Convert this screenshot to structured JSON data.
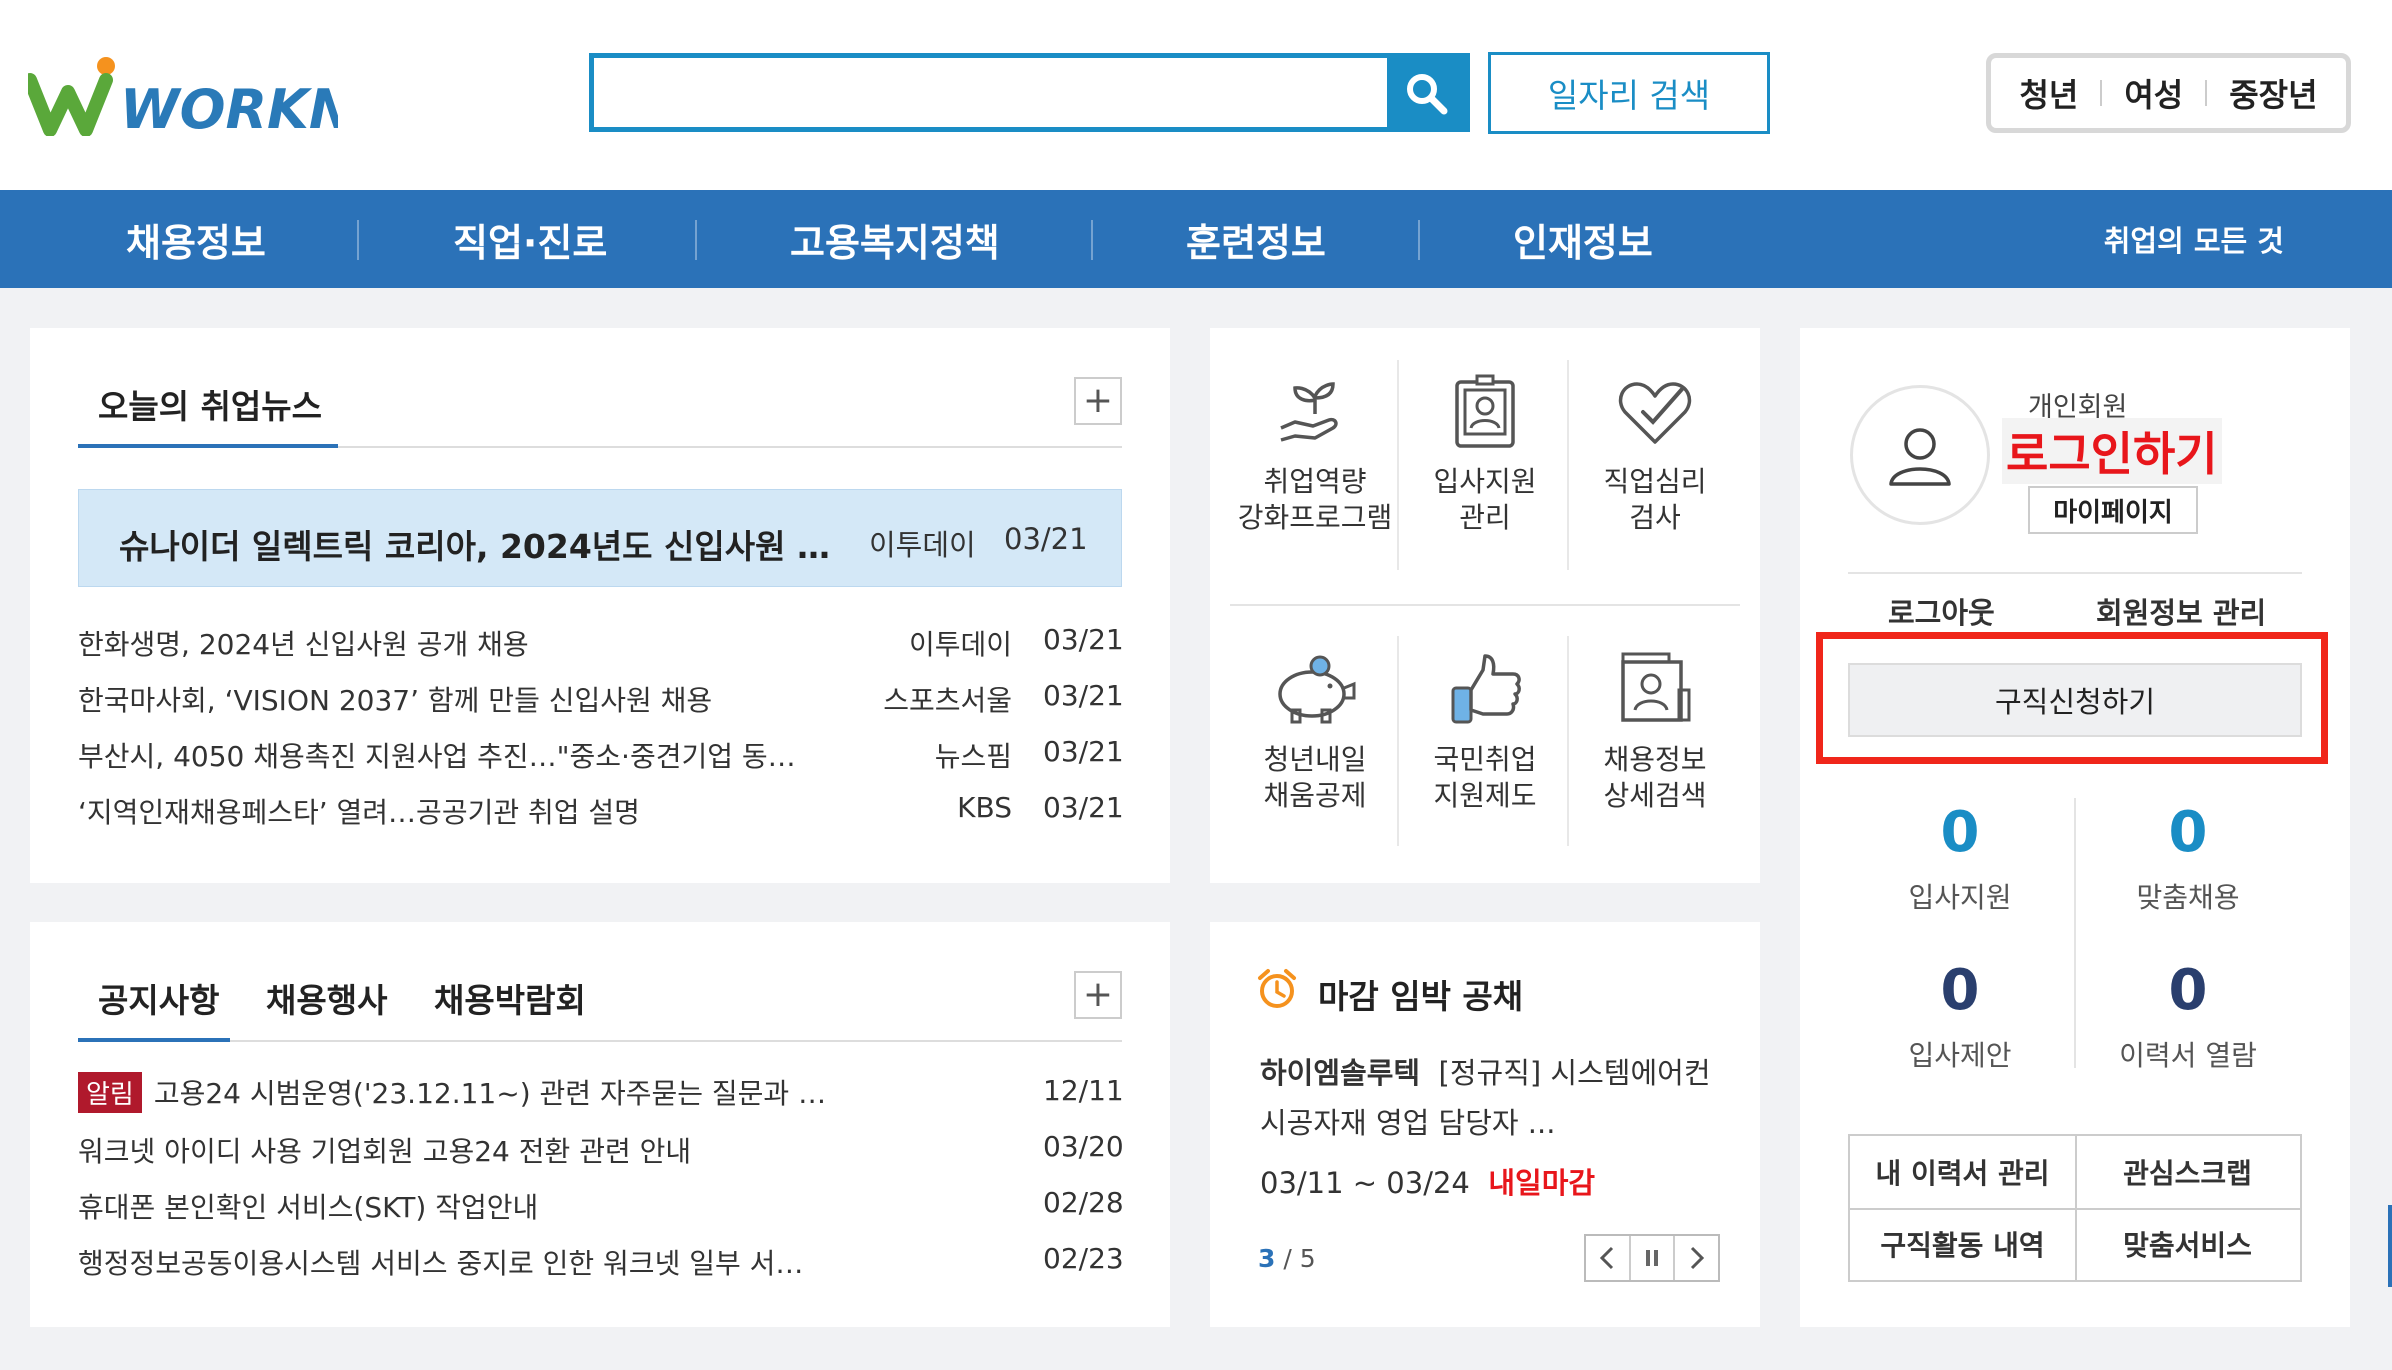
{
  "header": {
    "logo_text": "WORKNET",
    "search_placeholder": "",
    "job_search_label": "일자리 검색",
    "quick_tabs": [
      "청년",
      "여성",
      "중장년"
    ]
  },
  "nav": {
    "items": [
      "채용정보",
      "직업·진로",
      "고용복지정책",
      "훈련정보",
      "인재정보"
    ],
    "right_label": "취업의 모든 것"
  },
  "news": {
    "title": "오늘의 취업뉴스",
    "plus": "+",
    "highlight": {
      "title": "슈나이더 일렉트릭 코리아, 2024년도 신입사원 …",
      "source": "이투데이",
      "date": "03/21"
    },
    "items": [
      {
        "title": "한화생명, 2024년 신입사원 공개 채용",
        "source": "이투데이",
        "date": "03/21"
      },
      {
        "title": "한국마사회, ‘VISION 2037’ 함께 만들 신입사원 채용",
        "source": "스포츠서울",
        "date": "03/21"
      },
      {
        "title": "부산시, 4050 채용촉진 지원사업 추진…\"중소·중견기업 동…",
        "source": "뉴스핌",
        "date": "03/21"
      },
      {
        "title": "‘지역인재채용페스타’ 열려…공공기관 취업 설명",
        "source": "KBS",
        "date": "03/21"
      }
    ]
  },
  "notice": {
    "tabs": [
      "공지사항",
      "채용행사",
      "채용박람회"
    ],
    "plus": "+",
    "alert_badge": "알림",
    "items": [
      {
        "title": "고용24 시범운영('23.12.11~) 관련 자주묻는 질문과 …",
        "date": "12/11"
      },
      {
        "title": "워크넷 아이디 사용 기업회원 고용24 전환 관련 안내",
        "date": "03/20"
      },
      {
        "title": "휴대폰 본인확인 서비스(SKT) 작업안내",
        "date": "02/28"
      },
      {
        "title": "행정정보공동이용시스템 서비스 중지로 인한 워크넷 일부 서…",
        "date": "02/23"
      }
    ]
  },
  "services": {
    "items": [
      {
        "label": "취업역량\n강화프로그램",
        "icon": "sprout-hand-icon"
      },
      {
        "label": "입사지원\n관리",
        "icon": "id-badge-icon"
      },
      {
        "label": "직업심리\n검사",
        "icon": "heart-check-icon"
      },
      {
        "label": "청년내일\n채움공제",
        "icon": "piggy-bank-icon"
      },
      {
        "label": "국민취업\n지원제도",
        "icon": "thumbs-up-icon"
      },
      {
        "label": "채용정보\n상세검색",
        "icon": "profile-search-icon"
      }
    ]
  },
  "deadline": {
    "title": "마감 임박 공채",
    "company": "하이엠솔루텍",
    "line1_rest": "[정규직] 시스템에어컨",
    "line2": "시공자재 영업 담당자 ...",
    "period": "03/11 ~ 03/24",
    "urgent": "내일마감",
    "page_current": "3",
    "page_total": "/ 5"
  },
  "member": {
    "type": "개인회원",
    "login": "로그인하기",
    "mypage": "마이페이지",
    "logout": "로그아웃",
    "manage": "회원정보 관리",
    "apply": "구직신청하기",
    "stats": [
      {
        "value": "0",
        "label": "입사지원"
      },
      {
        "value": "0",
        "label": "맞춤채용"
      },
      {
        "value": "0",
        "label": "입사제안"
      },
      {
        "value": "0",
        "label": "이력서 열람"
      }
    ],
    "buttons": [
      "내 이력서 관리",
      "관심스크랩",
      "구직활동 내역",
      "맞춤서비스"
    ]
  },
  "colors": {
    "brand_blue": "#2b72b8",
    "search_blue": "#1a8dc5",
    "stat_teal": "#1a8dc5",
    "stat_navy": "#2a3f6e",
    "alert_red": "#e8161b"
  }
}
